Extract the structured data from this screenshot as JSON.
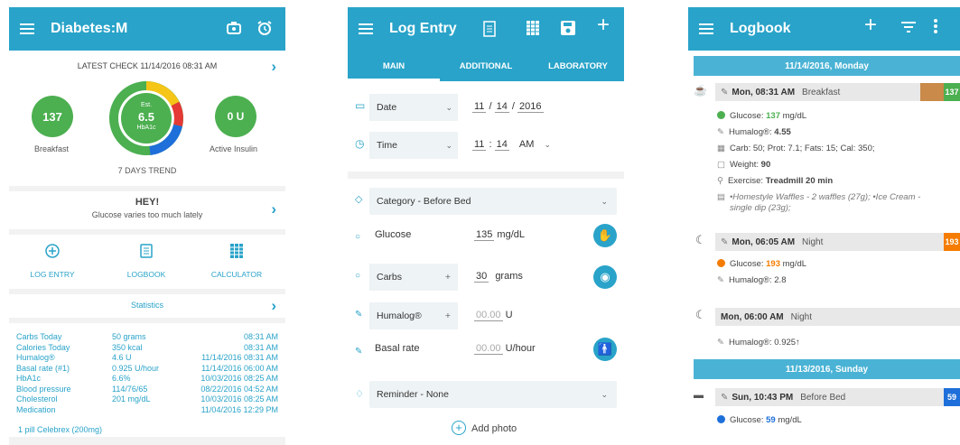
{
  "screen1": {
    "title": "Diabetes:M",
    "latest_check": "LATEST CHECK 11/14/2016 08:31 AM",
    "glucose_value": "137",
    "glucose_label": "Breakfast",
    "hba1c_est": "Est.",
    "hba1c_value": "6.5",
    "hba1c_label": "HbA1c",
    "insulin_value": "0 U",
    "insulin_label": "Active Insulin",
    "trend_label": "7 DAYS TREND",
    "hey_title": "HEY!",
    "hey_text": "Glucose varies too much lately",
    "actions": [
      "LOG ENTRY",
      "LOGBOOK",
      "CALCULATOR"
    ],
    "statistics_label": "Statistics",
    "stats": [
      {
        "label": "Carbs Today",
        "value": "50 grams",
        "time": "08:31 AM"
      },
      {
        "label": "Calories Today",
        "value": "350 kcal",
        "time": "08:31 AM"
      },
      {
        "label": "Humalog®",
        "value": "4.6 U",
        "time": "11/14/2016 08:31 AM"
      },
      {
        "label": "Basal rate (#1)",
        "value": "0.925 U/hour",
        "time": "11/14/2016 06:00 AM"
      },
      {
        "label": "HbA1c",
        "value": "6.6%",
        "time": "10/03/2016 08:25 AM"
      },
      {
        "label": "Blood pressure",
        "value": "114/76/65",
        "time": "08/22/2016 04:52 AM"
      },
      {
        "label": "Cholesterol",
        "value": "201 mg/dL",
        "time": "10/03/2016 08:25 AM"
      },
      {
        "label": "Medication",
        "value": "",
        "time": "11/04/2016 12:29 PM"
      }
    ],
    "medication_detail": "1 pill Celebrex (200mg)",
    "colors": {
      "accent": "#29a3c9",
      "green": "#4caf50",
      "red": "#e53935",
      "blue": "#1e6fd9",
      "yellow": "#f5c518"
    }
  },
  "screen2": {
    "title": "Log Entry",
    "tabs": [
      "MAIN",
      "ADDITIONAL",
      "LABORATORY"
    ],
    "date_label": "Date",
    "date_month": "11",
    "date_day": "14",
    "date_year": "2016",
    "time_label": "Time",
    "time_hour": "11",
    "time_min": "14",
    "time_ampm": "AM",
    "category": "Category - Before Bed",
    "glucose_label": "Glucose",
    "glucose_value": "135",
    "glucose_unit": "mg/dL",
    "carbs_label": "Carbs",
    "carbs_value": "30",
    "carbs_unit": "grams",
    "humalog_label": "Humalog®",
    "humalog_value": "00.00",
    "humalog_unit": "U",
    "basal_label": "Basal rate",
    "basal_value": "00.00",
    "basal_unit": "U/hour",
    "reminder": "Reminder - None",
    "add_photo": "Add photo",
    "plus": "+"
  },
  "screen3": {
    "title": "Logbook",
    "day1": "11/14/2016, Monday",
    "entry1": {
      "time": "Mon, 08:31 AM",
      "category": "Breakfast",
      "tag": "137"
    },
    "entry1_lines": {
      "glucose_prefix": "Glucose: ",
      "glucose_val": "137",
      "glucose_unit": " mg/dL",
      "humalog_prefix": "Humalog®: ",
      "humalog_val": "4.55",
      "food": "Carb: 50; Prot: 7.1; Fats: 15; Cal: 350;",
      "weight_prefix": "Weight: ",
      "weight_val": "90",
      "exercise_prefix": "Exercise: ",
      "exercise_val": "Treadmill 20 min",
      "notes": "•Homestyle Waffles - 2 waffles (27g); •Ice Cream - single dip (23g);"
    },
    "entry2": {
      "time": "Mon, 06:05 AM",
      "category": "Night",
      "tag": "193"
    },
    "entry2_lines": {
      "glucose_prefix": "Glucose: ",
      "glucose_val": "193",
      "glucose_unit": " mg/dL",
      "humalog": "Humalog®: 2.8"
    },
    "entry3": {
      "time": "Mon, 06:00 AM",
      "category": "Night"
    },
    "entry3_line": "Humalog®: 0.925↑",
    "day2": "11/13/2016, Sunday",
    "entry4": {
      "time": "Sun, 10:43 PM",
      "category": "Before Bed",
      "tag": "59"
    },
    "entry4_line": {
      "glucose_prefix": "Glucose: ",
      "glucose_val": "59",
      "glucose_unit": " mg/dL"
    }
  }
}
